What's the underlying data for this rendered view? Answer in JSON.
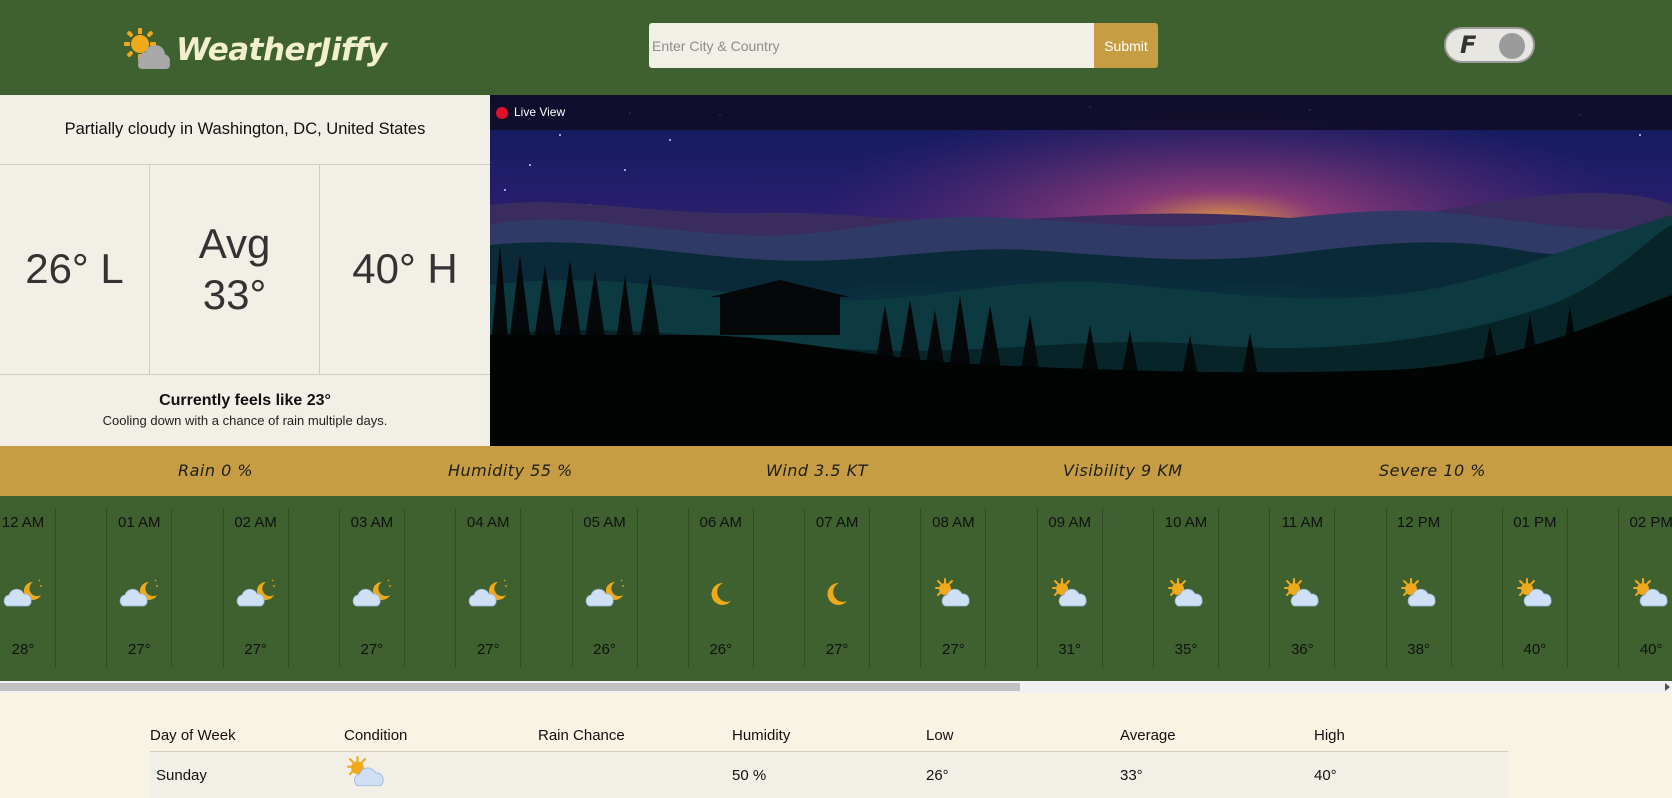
{
  "header": {
    "brand": "WeatherJiffy",
    "search_placeholder": "Enter City & Country",
    "search_value": "",
    "submit_label": "Submit",
    "unit_toggle": "F"
  },
  "summary": {
    "location_text": "Partially cloudy in Washington, DC, United States",
    "low": "26° L",
    "avg_label": "Avg",
    "avg_value": "33°",
    "high": "40° H",
    "feels_like": "Currently feels like 23°",
    "description": "Cooling down with a chance of rain multiple days."
  },
  "live_view": {
    "label": "Live View"
  },
  "stats": [
    {
      "label": "Rain 0 %"
    },
    {
      "label": "Humidity 55 %"
    },
    {
      "label": "Wind 3.5 KT"
    },
    {
      "label": "Visibility 9 KM"
    },
    {
      "label": "Severe 10 %"
    }
  ],
  "hourly": [
    {
      "time": "12 AM",
      "temp": "28°",
      "icon": "cloud-moon-icon"
    },
    {
      "time": "01 AM",
      "temp": "27°",
      "icon": "cloud-moon-icon"
    },
    {
      "time": "02 AM",
      "temp": "27°",
      "icon": "cloud-moon-icon"
    },
    {
      "time": "03 AM",
      "temp": "27°",
      "icon": "cloud-moon-icon"
    },
    {
      "time": "04 AM",
      "temp": "27°",
      "icon": "cloud-moon-icon"
    },
    {
      "time": "05 AM",
      "temp": "26°",
      "icon": "cloud-moon-icon"
    },
    {
      "time": "06 AM",
      "temp": "26°",
      "icon": "moon-icon"
    },
    {
      "time": "07 AM",
      "temp": "27°",
      "icon": "moon-icon"
    },
    {
      "time": "08 AM",
      "temp": "27°",
      "icon": "sun-cloud-icon"
    },
    {
      "time": "09 AM",
      "temp": "31°",
      "icon": "sun-cloud-icon"
    },
    {
      "time": "10 AM",
      "temp": "35°",
      "icon": "sun-cloud-icon"
    },
    {
      "time": "11 AM",
      "temp": "36°",
      "icon": "sun-cloud-icon"
    },
    {
      "time": "12 PM",
      "temp": "38°",
      "icon": "sun-cloud-icon"
    },
    {
      "time": "01 PM",
      "temp": "40°",
      "icon": "sun-cloud-icon"
    },
    {
      "time": "02 PM",
      "temp": "40°",
      "icon": "sun-cloud-icon"
    }
  ],
  "daily": {
    "headers": [
      "Day of Week",
      "Condition",
      "Rain Chance",
      "Humidity",
      "Low",
      "Average",
      "High"
    ],
    "rows": [
      {
        "day": "Sunday",
        "condition_icon": "sun-cloud-icon",
        "rain": "",
        "humidity": "50 %",
        "low": "26°",
        "avg": "33°",
        "high": "40°"
      }
    ]
  },
  "colors": {
    "header_green": "#3f612f",
    "accent_gold": "#c79d44",
    "panel_cream": "#f1efe6",
    "page_bg": "#f8f3e2"
  }
}
